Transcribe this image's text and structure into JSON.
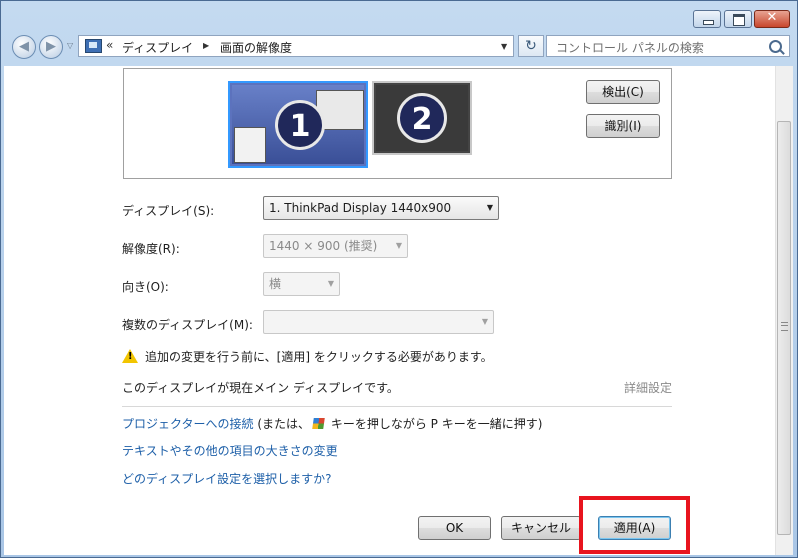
{
  "titlebar": {
    "minimize_icon": "minimize-icon",
    "maximize_icon": "maximize-icon",
    "close_icon": "close-icon",
    "close_symbol": "✕"
  },
  "nav": {
    "back_symbol": "◀",
    "forward_symbol": "▶",
    "history_drop": "▽"
  },
  "address": {
    "icon": "display-icon",
    "chevron": "«",
    "parts": [
      "ディスプレイ",
      "画面の解像度"
    ],
    "separator": "▶",
    "dropdown": "▼",
    "refresh_symbol": "↻"
  },
  "search": {
    "placeholder": "コントロール パネルの検索"
  },
  "monitors": {
    "primary": "1",
    "secondary": "2"
  },
  "buttons": {
    "detect": "検出(C)",
    "identify": "識別(I)",
    "ok": "OK",
    "cancel": "キャンセル",
    "apply": "適用(A)"
  },
  "settings": {
    "display_label": "ディスプレイ(S):",
    "display_value": "1. ThinkPad Display 1440x900",
    "resolution_label": "解像度(R):",
    "resolution_value": "1440 × 900 (推奨)",
    "orientation_label": "向き(O):",
    "orientation_value": "横",
    "multiple_label": "複数のディスプレイ(M):",
    "multiple_value": ""
  },
  "messages": {
    "warning": "追加の変更を行う前に、[適用] をクリックする必要があります。",
    "primary_note": "このディスプレイが現在メイン ディスプレイです。",
    "advanced": "詳細設定"
  },
  "links": {
    "projector": "プロジェクターへの接続",
    "projector_suffix_a": " (または、",
    "projector_suffix_b": " キーを押しながら P キーを一緒に押す)",
    "text_size": "テキストやその他の項目の大きさの変更",
    "which_settings": "どのディスプレイ設定を選択しますか?"
  },
  "colors": {
    "highlight": "#e8141e",
    "link": "#1d5fa8"
  }
}
